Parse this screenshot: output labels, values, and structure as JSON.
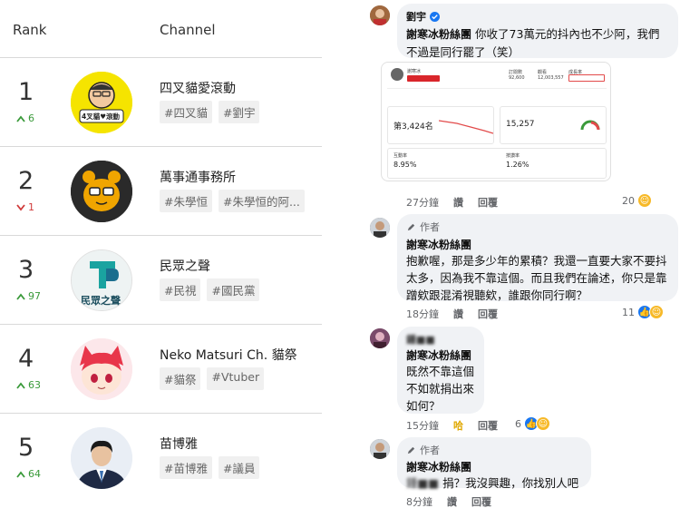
{
  "ranking": {
    "header_rank": "Rank",
    "header_channel": "Channel",
    "rows": [
      {
        "rank": "1",
        "delta": "6",
        "direction": "up",
        "name": "四叉貓愛滾動",
        "tags": [
          "#四叉貓",
          "#劉宇"
        ],
        "avatar_text": "4叉貓♥滾動"
      },
      {
        "rank": "2",
        "delta": "1",
        "direction": "down",
        "name": "萬事通事務所",
        "tags": [
          "#朱學恒",
          "#朱學恒的阿..."
        ],
        "avatar_text": ""
      },
      {
        "rank": "3",
        "delta": "97",
        "direction": "up",
        "name": "民眾之聲",
        "tags": [
          "#民視",
          "#國民黨"
        ],
        "avatar_text": "民眾之聲"
      },
      {
        "rank": "4",
        "delta": "63",
        "direction": "up",
        "name": "Neko Matsuri Ch. 貓祭",
        "tags": [
          "#貓祭",
          "#Vtuber"
        ],
        "avatar_text": ""
      },
      {
        "rank": "5",
        "delta": "64",
        "direction": "up",
        "name": "苗博雅",
        "tags": [
          "#苗博雅",
          "#議員"
        ],
        "avatar_text": ""
      }
    ]
  },
  "comments": [
    {
      "author": "劉宇",
      "verified": true,
      "mention": "謝寒冰粉絲團",
      "text": "你收了73萬元的抖內也不少阿，我們不過是同行罷了（笑）",
      "time": "27分鐘",
      "like_label": "讚",
      "reply_label": "回覆",
      "reaction_count": "20"
    },
    {
      "author_badge": "作者",
      "mention": "謝寒冰粉絲團",
      "text": "抱歉喔，那是多少年的累積？我還一直要大家不要抖太多，因為我不靠這個。而且我們在論述，你只是靠蹭欸跟混淆視聽欸，誰跟你同行啊？",
      "time": "18分鐘",
      "like_label": "讚",
      "reply_label": "回覆",
      "reaction_count": "11"
    },
    {
      "author": "鍾■■",
      "mention": "謝寒冰粉絲團",
      "text": "既然不靠這個不如就捐出來如何？",
      "time": "15分鐘",
      "like_label": "哈",
      "reply_label": "回覆",
      "reaction_count": "6"
    },
    {
      "author_badge": "作者",
      "mention": "謝寒冰粉絲團",
      "blurred_name": "鍾■■",
      "text": "捐？我沒興趣，你找別人吧",
      "time": "8分鐘",
      "like_label": "讚",
      "reply_label": "回覆"
    }
  ],
  "embedded_screenshot": {
    "channel_name": "謝寒冰",
    "subscriber_rank": "第3,424名",
    "avg_views": "15,257",
    "engagement_rate": "8.95%",
    "interaction_rate": "1.26%",
    "stats": [
      "92,600",
      "12,003,557"
    ],
    "label_subs": "訂閱數",
    "label_views": "觀看",
    "label_growth": "成長率",
    "label_engagement": "互動率",
    "label_like": "按讚率"
  },
  "colors": {
    "up": "#3a9a3a",
    "down": "#d03a3a",
    "fb_blue": "#1877f2",
    "bubble": "#f0f2f5"
  }
}
